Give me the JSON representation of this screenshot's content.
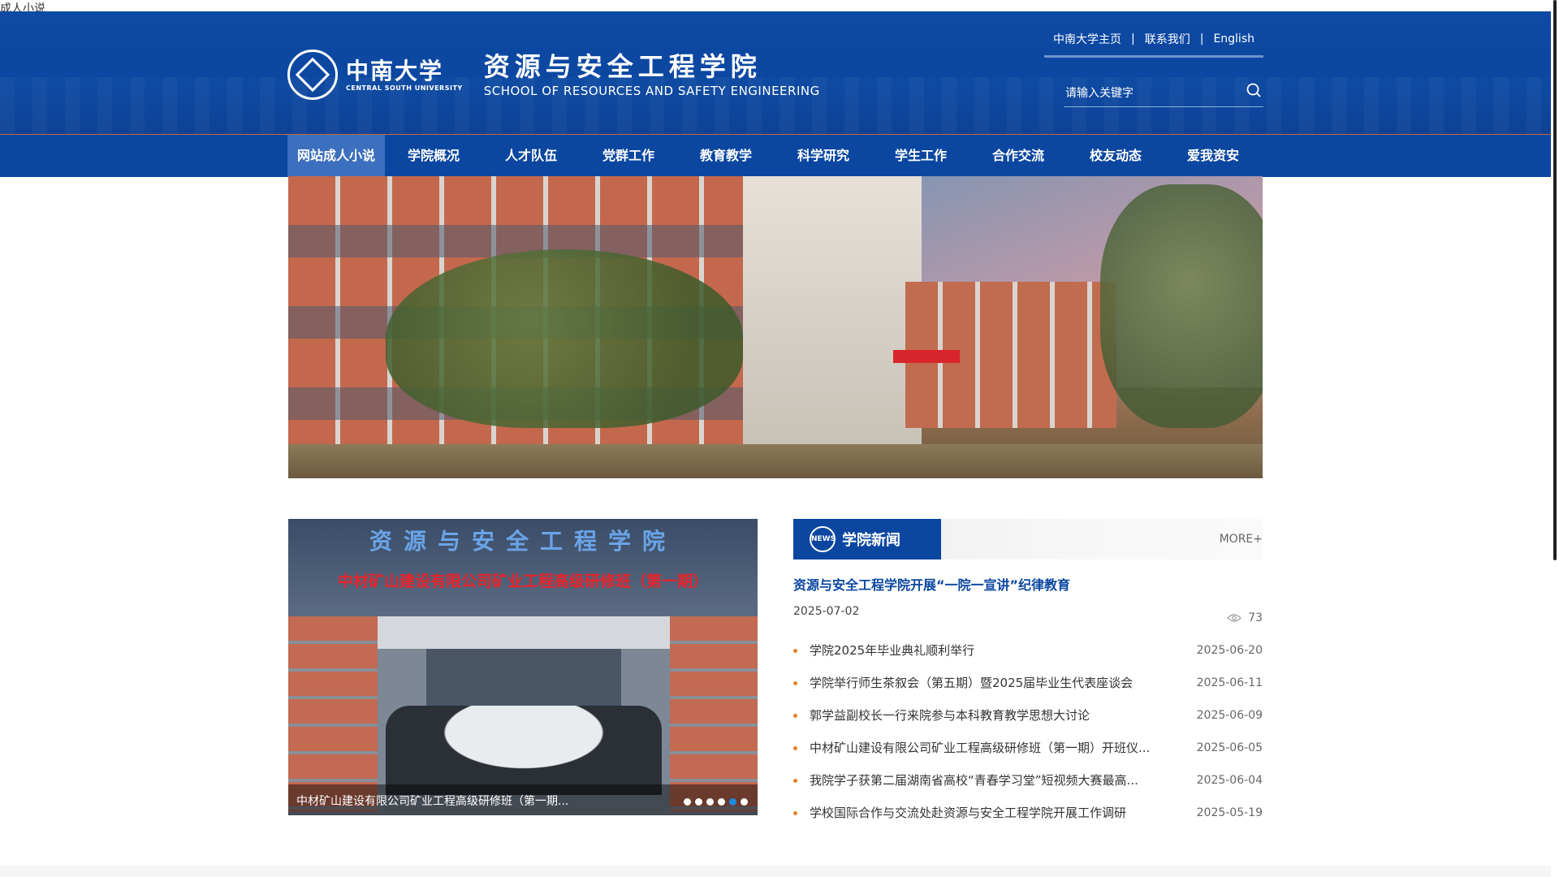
{
  "page_top_text": "成人小说",
  "header": {
    "university_cn": "中南大学",
    "university_en": "CENTRAL SOUTH UNIVERSITY",
    "school_cn": "资源与安全工程学院",
    "school_en": "SCHOOL OF RESOURCES AND  SAFETY ENGINEERING",
    "top_links": [
      "中南大学主页",
      "联系我们",
      "English"
    ],
    "search_placeholder": "请输入关键字"
  },
  "nav": {
    "items": [
      "网站成人小说",
      "学院概况",
      "人才队伍",
      "党群工作",
      "教育教学",
      "科学研究",
      "学生工作",
      "合作交流",
      "校友动态",
      "爱我资安"
    ],
    "active_index": 0
  },
  "banner": {
    "dot_count": 6,
    "active_dot": 2
  },
  "photo_slider": {
    "sign_text": "资源与安全工程学院",
    "banner_text": "中材矿山建设有限公司矿业工程高级研修班（第一期）",
    "caption": "中材矿山建设有限公司矿业工程高级研修班（第一期...",
    "dot_count": 6,
    "active_dot": 4
  },
  "news": {
    "section_title": "学院新闻",
    "icon_label": "NEWS",
    "more_label": "MORE+",
    "headline": "资源与安全工程学院开展“一院一宣讲”纪律教育",
    "headline_date": "2025-07-02",
    "headline_views": "73",
    "items": [
      {
        "title": "学院2025年毕业典礼顺利举行",
        "date": "2025-06-20"
      },
      {
        "title": "学院举行师生茶叙会（第五期）暨2025届毕业生代表座谈会",
        "date": "2025-06-11"
      },
      {
        "title": "郭学益副校长一行来院参与本科教育教学思想大讨论",
        "date": "2025-06-09"
      },
      {
        "title": "中材矿山建设有限公司矿业工程高级研修班（第一期）开班仪...",
        "date": "2025-06-05"
      },
      {
        "title": "我院学子获第二届湖南省高校“青春学习堂”短视频大赛最高...",
        "date": "2025-06-04"
      },
      {
        "title": "学校国际合作与交流处赴资源与安全工程学院开展工作调研",
        "date": "2025-05-19"
      }
    ]
  },
  "colors": {
    "brand_blue": "#0b47a1",
    "accent_orange": "#f4a214",
    "bullet_orange": "#e6822a"
  }
}
